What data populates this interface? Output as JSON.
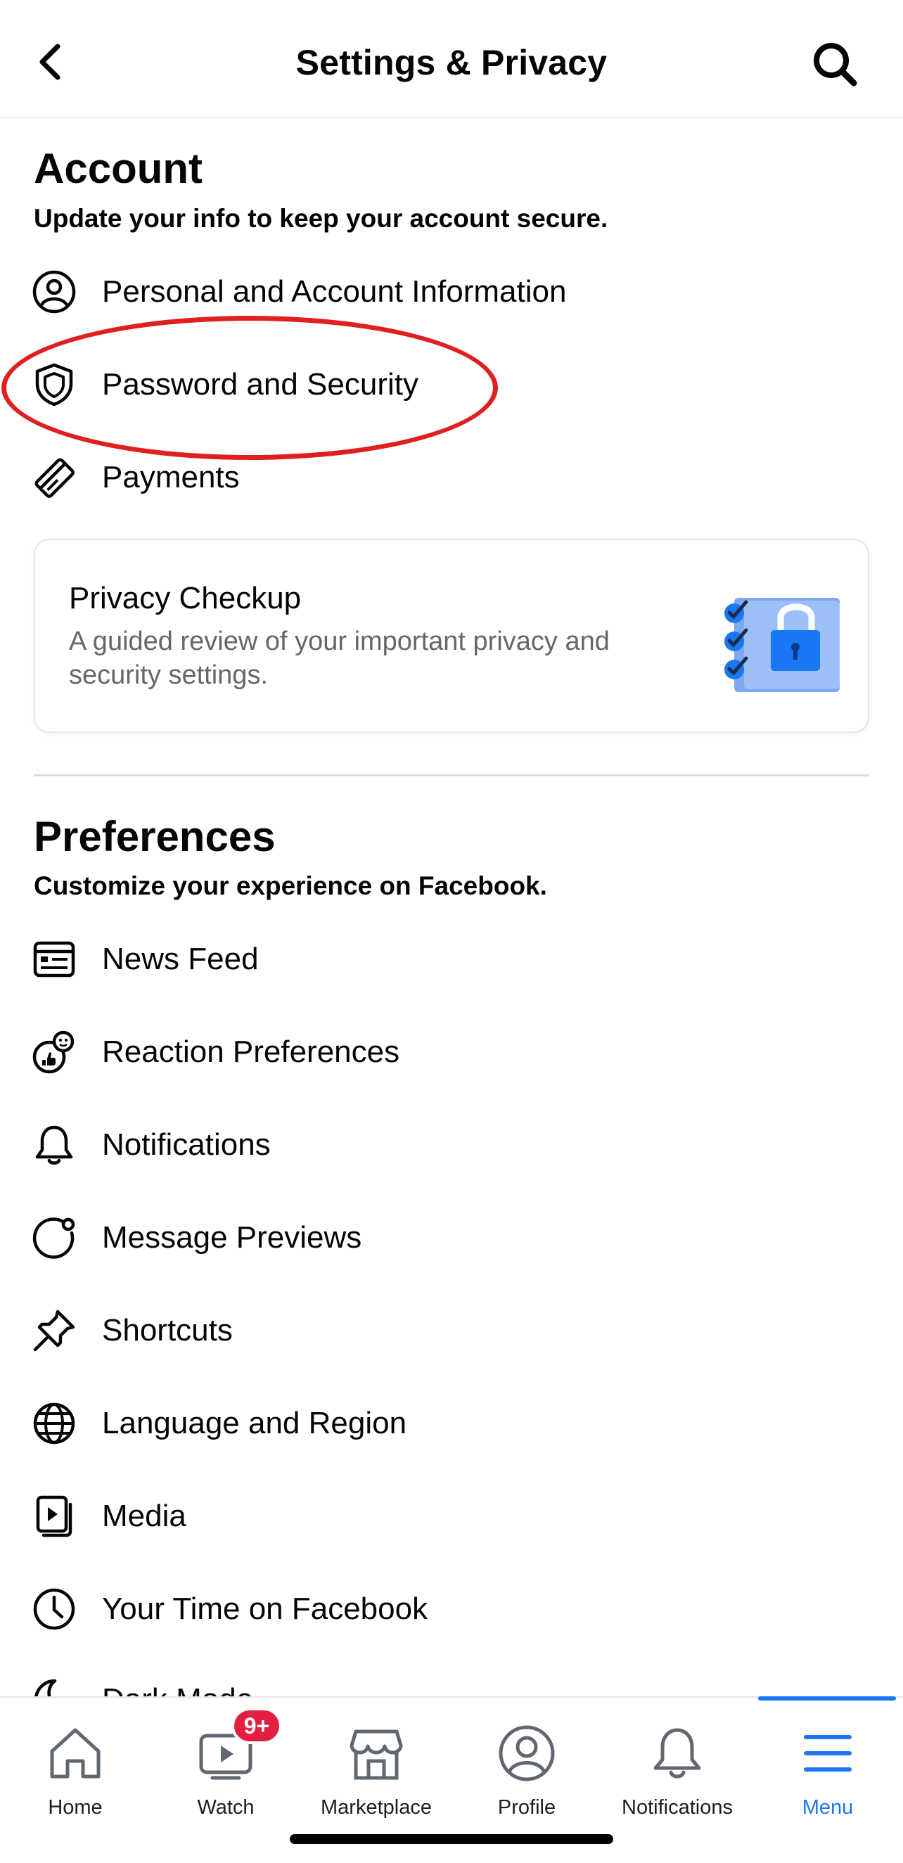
{
  "header": {
    "title": "Settings & Privacy",
    "back_icon": "chevron-left-icon",
    "search_icon": "search-icon"
  },
  "account": {
    "title": "Account",
    "subtitle": "Update your info to keep your account secure.",
    "items": [
      {
        "label": "Personal and Account Information",
        "icon": "user-circle-icon"
      },
      {
        "label": "Password and Security",
        "icon": "shield-icon"
      },
      {
        "label": "Payments",
        "icon": "card-icon"
      }
    ]
  },
  "privacy_checkup": {
    "title": "Privacy Checkup",
    "description": "A guided review of your important privacy and security settings."
  },
  "preferences": {
    "title": "Preferences",
    "subtitle": "Customize your experience on Facebook.",
    "items": [
      {
        "label": "News Feed",
        "icon": "news-feed-icon"
      },
      {
        "label": "Reaction Preferences",
        "icon": "reaction-icon"
      },
      {
        "label": "Notifications",
        "icon": "bell-icon"
      },
      {
        "label": "Message Previews",
        "icon": "message-preview-icon"
      },
      {
        "label": "Shortcuts",
        "icon": "pin-icon"
      },
      {
        "label": "Language and Region",
        "icon": "globe-icon"
      },
      {
        "label": "Media",
        "icon": "media-icon"
      },
      {
        "label": "Your Time on Facebook",
        "icon": "clock-icon"
      },
      {
        "label": "Dark Mode",
        "icon": "moon-icon"
      }
    ]
  },
  "tabbar": {
    "tabs": [
      {
        "label": "Home",
        "icon": "home-icon"
      },
      {
        "label": "Watch",
        "icon": "watch-icon",
        "badge": "9+"
      },
      {
        "label": "Marketplace",
        "icon": "marketplace-icon"
      },
      {
        "label": "Profile",
        "icon": "profile-icon"
      },
      {
        "label": "Notifications",
        "icon": "bell-icon"
      },
      {
        "label": "Menu",
        "icon": "menu-icon",
        "active": true
      }
    ]
  },
  "colors": {
    "accent": "#1877f2",
    "badge": "#e41e3f",
    "annotation": "#e02020",
    "secondary_text": "#65676b"
  }
}
